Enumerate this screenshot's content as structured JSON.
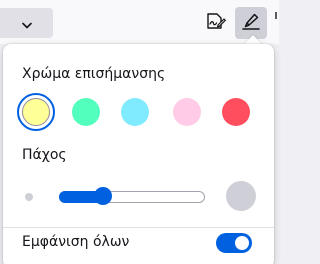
{
  "toolbar": {
    "dropdown_icon": "chevron-down-icon",
    "signature_icon": "signature-icon",
    "highlight_icon": "highlighter-icon"
  },
  "highlight_panel": {
    "color_section_label": "Χρώμα επισήμανσης",
    "colors": [
      {
        "name": "yellow",
        "hex": "#ffff98",
        "selected": true
      },
      {
        "name": "green",
        "hex": "#53ffbc",
        "selected": false
      },
      {
        "name": "blue",
        "hex": "#80ebff",
        "selected": false
      },
      {
        "name": "pink",
        "hex": "#ffcbe6",
        "selected": false
      },
      {
        "name": "red",
        "hex": "#ff4f5f",
        "selected": false
      }
    ],
    "thickness_label": "Πάχος",
    "thickness_level": 0.27,
    "show_all_label": "Εμφάνιση όλων",
    "show_all_on": true
  },
  "colors": {
    "accent": "#0061e0",
    "toolbar_bg": "#f9f9fb",
    "active_button_bg": "#cfcfd8"
  }
}
